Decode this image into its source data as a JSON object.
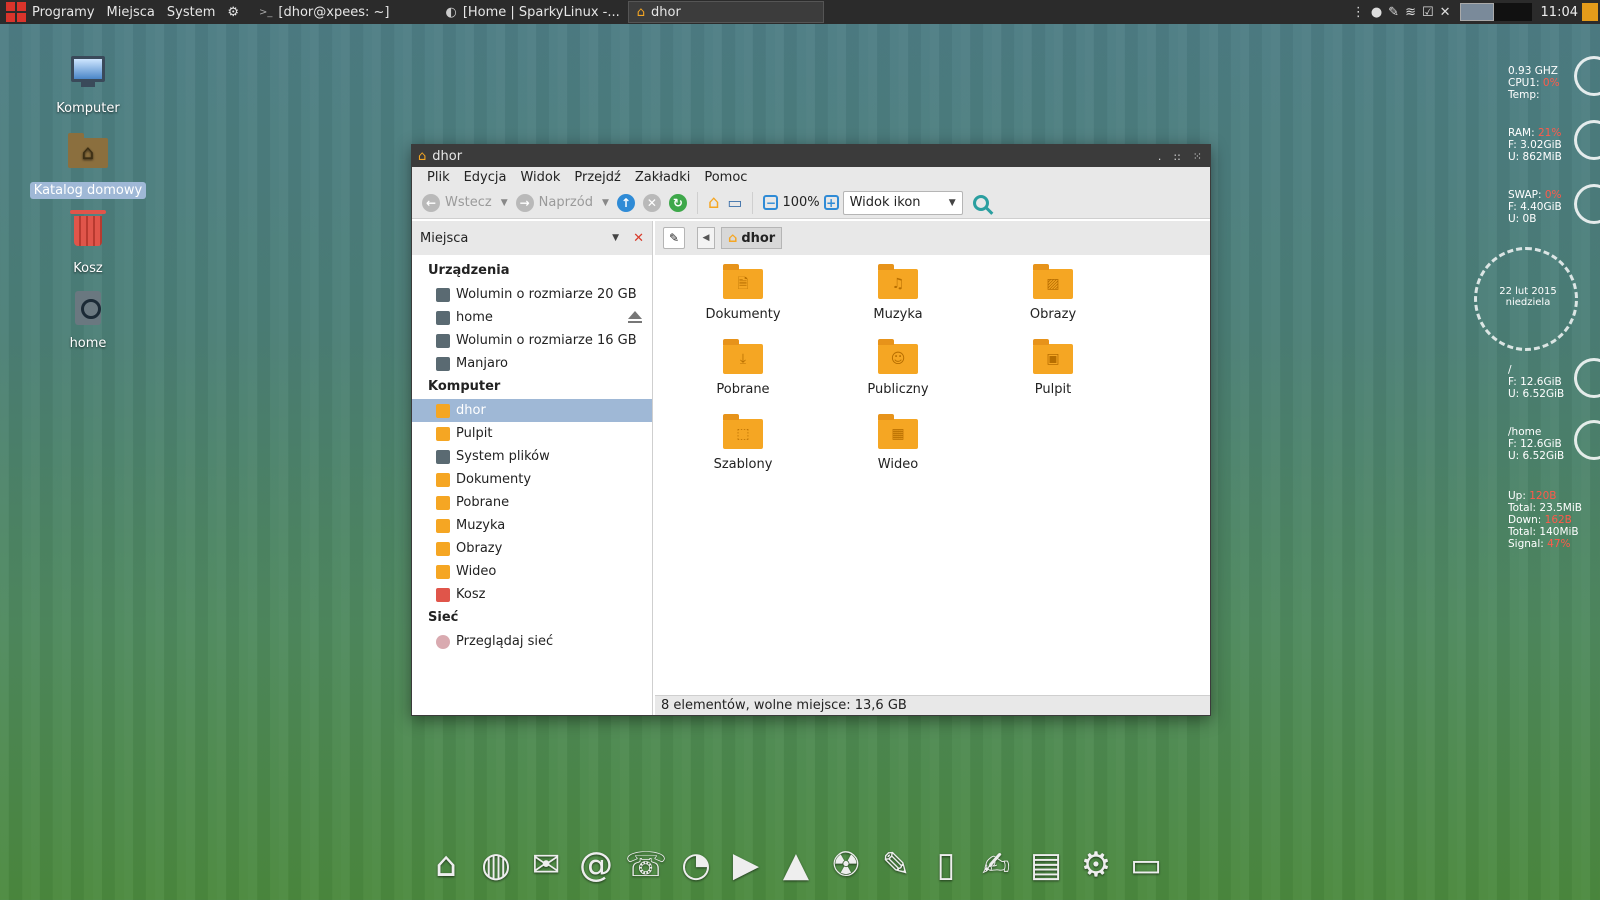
{
  "top_panel": {
    "menus": [
      "Programy",
      "Miejsca",
      "System"
    ],
    "tasks": [
      {
        "label": "[dhor@xpees: ~]",
        "icon": "terminal-icon"
      },
      {
        "label": "[Home | SparkyLinux -...",
        "icon": "browser-icon"
      },
      {
        "label": "dhor",
        "icon": "home-folder-icon",
        "active": true
      }
    ],
    "clock": "11:04"
  },
  "desktop": {
    "icons": [
      {
        "label": "Komputer",
        "icon": "computer-icon"
      },
      {
        "label": "Katalog domowy",
        "icon": "home-folder-icon",
        "selected": true
      },
      {
        "label": "Kosz",
        "icon": "trash-icon"
      },
      {
        "label": "home",
        "icon": "drive-icon"
      }
    ]
  },
  "window": {
    "title": "dhor",
    "menu": [
      "Plik",
      "Edycja",
      "Widok",
      "Przejdź",
      "Zakładki",
      "Pomoc"
    ],
    "toolbar": {
      "back_label": "Wstecz",
      "forward_label": "Naprzód",
      "zoom": "100%",
      "view_mode": "Widok ikon"
    },
    "sidebar_header": "Miejsca",
    "breadcrumb": "dhor",
    "sidebar": {
      "sections": [
        {
          "title": "Urządzenia",
          "items": [
            {
              "label": "Wolumin o rozmiarze 20 GB",
              "icon": "drive-icon"
            },
            {
              "label": "home",
              "icon": "drive-icon",
              "eject": true
            },
            {
              "label": "Wolumin o rozmiarze 16 GB",
              "icon": "drive-icon"
            },
            {
              "label": "Manjaro",
              "icon": "drive-icon"
            }
          ]
        },
        {
          "title": "Komputer",
          "items": [
            {
              "label": "dhor",
              "icon": "home-icon",
              "selected": true
            },
            {
              "label": "Pulpit",
              "icon": "desktop-icon"
            },
            {
              "label": "System plików",
              "icon": "drive-icon"
            },
            {
              "label": "Dokumenty",
              "icon": "documents-icon"
            },
            {
              "label": "Pobrane",
              "icon": "downloads-icon"
            },
            {
              "label": "Muzyka",
              "icon": "music-icon"
            },
            {
              "label": "Obrazy",
              "icon": "pictures-icon"
            },
            {
              "label": "Wideo",
              "icon": "video-icon"
            },
            {
              "label": "Kosz",
              "icon": "trash-icon"
            }
          ]
        },
        {
          "title": "Sieć",
          "items": [
            {
              "label": "Przeglądaj sieć",
              "icon": "network-icon"
            }
          ]
        }
      ]
    },
    "files": [
      {
        "label": "Dokumenty",
        "glyph": "🗎"
      },
      {
        "label": "Muzyka",
        "glyph": "♫"
      },
      {
        "label": "Obrazy",
        "glyph": "▨"
      },
      {
        "label": "Pobrane",
        "glyph": "⤓"
      },
      {
        "label": "Publiczny",
        "glyph": "☺"
      },
      {
        "label": "Pulpit",
        "glyph": "▣"
      },
      {
        "label": "Szablony",
        "glyph": "⬚"
      },
      {
        "label": "Wideo",
        "glyph": "▦"
      }
    ],
    "status": "8 elementów, wolne miejsce: 13,6 GB"
  },
  "conky": {
    "cpu": {
      "freq": "0.93 GHZ",
      "cpu_label": "CPU1:",
      "cpu_value": "0%",
      "temp_label": "Temp:"
    },
    "ram": {
      "ram_label": "RAM:",
      "ram_value": "21%",
      "free": "F: 3.02GiB",
      "used": "U: 862MiB"
    },
    "swap": {
      "swap_label": "SWAP:",
      "swap_value": "0%",
      "free": "F: 4.40GiB",
      "used": "U: 0B"
    },
    "date": {
      "date": "22 lut 2015",
      "day": "niedziela"
    },
    "root": {
      "path": "/",
      "free": "F: 12.6GiB",
      "used": "U: 6.52GiB"
    },
    "home": {
      "path": "/home",
      "free": "F: 12.6GiB",
      "used": "U: 6.52GiB"
    },
    "net": {
      "up_label": "Up:",
      "up_value": "120B",
      "up_total": "Total: 23.5MiB",
      "down_label": "Down:",
      "down_value": "162B",
      "down_total": "Total: 140MiB",
      "signal_label": "Signal:",
      "signal_value": "47%"
    }
  },
  "dock": {
    "icons": [
      {
        "name": "home-icon",
        "glyph": "⌂"
      },
      {
        "name": "globe-icon",
        "glyph": "◍"
      },
      {
        "name": "mail-icon",
        "glyph": "✉"
      },
      {
        "name": "email-client-icon",
        "glyph": "@"
      },
      {
        "name": "chat-icon",
        "glyph": "☏"
      },
      {
        "name": "rss-icon",
        "glyph": "◔"
      },
      {
        "name": "media-player-icon",
        "glyph": "▶"
      },
      {
        "name": "vlc-icon",
        "glyph": "▲"
      },
      {
        "name": "burner-icon",
        "glyph": "☢"
      },
      {
        "name": "gimp-icon",
        "glyph": "✎"
      },
      {
        "name": "text-editor-icon",
        "glyph": "▯"
      },
      {
        "name": "office-icon",
        "glyph": "✍"
      },
      {
        "name": "firewall-icon",
        "glyph": "▤"
      },
      {
        "name": "settings-icon",
        "glyph": "⚙"
      },
      {
        "name": "terminal-icon",
        "glyph": "▭"
      }
    ]
  }
}
